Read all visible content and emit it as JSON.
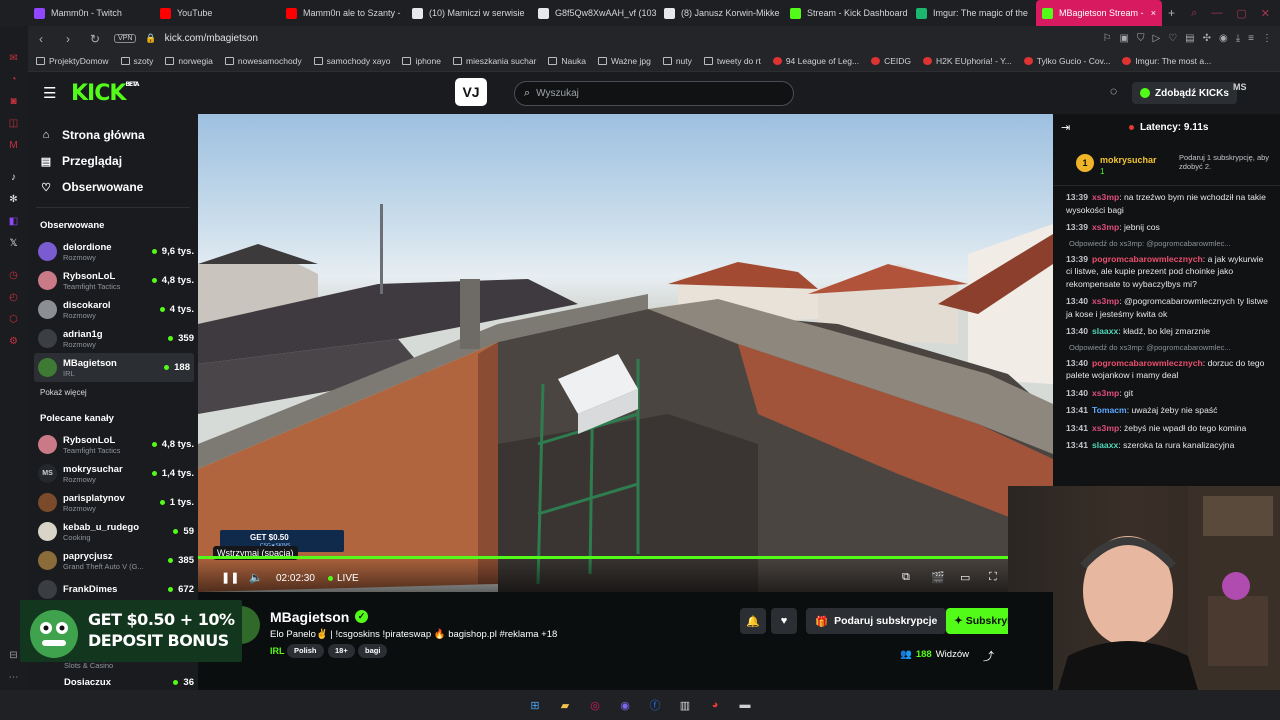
{
  "browser": {
    "tabs": [
      {
        "label": "Mamm0n - Twitch",
        "color": "#9146ff"
      },
      {
        "label": "YouTube",
        "color": "#ff0000"
      },
      {
        "label": "Mamm0n ale to Szanty -",
        "color": "#ff0000"
      },
      {
        "label": "(10) Mamiczi w serwisie",
        "color": "#e6e8ea"
      },
      {
        "label": "G8f5Qw8XwAAH_vf (103",
        "color": "#e6e8ea"
      },
      {
        "label": "(8) Janusz Korwin-Mikke",
        "color": "#e6e8ea"
      },
      {
        "label": "Stream - Kick Dashboard",
        "color": "#53fc18"
      },
      {
        "label": "Imgur: The magic of the",
        "color": "#1bb76e"
      },
      {
        "label": "MBagietson Stream -",
        "color": "#53fc18",
        "active": true
      }
    ],
    "new_tab": "+",
    "vpn_label": "VPN",
    "url": "kick.com/mbagietson",
    "bookmarks": [
      "ProjektyDomow",
      "szoty",
      "norwegia",
      "nowesamochody",
      "samochody xayo",
      "iphone",
      "mieszkania suchar",
      "Nauka",
      "Ważne jpg",
      "nuty",
      "tweety do rt",
      "94 League of Leg...",
      "CEIDG",
      "H2K EUphoria! - Y...",
      "Tylko Gucio - Cov...",
      "Imgur: The most a..."
    ]
  },
  "kick": {
    "logo": "KICK",
    "logo_beta": "BETA",
    "vj_label": "VJ",
    "search_placeholder": "Wyszukaj",
    "kicks_button": "Zdobądź KICKs",
    "user_initials": "MS",
    "nav": [
      {
        "label": "Strona główna",
        "icon": "home-icon"
      },
      {
        "label": "Przeglądaj",
        "icon": "browse-icon"
      },
      {
        "label": "Obserwowane",
        "icon": "heart-icon"
      }
    ],
    "followed_heading": "Obserwowane",
    "followed": [
      {
        "name": "delordione",
        "category": "Rozmowy",
        "viewers": "9,6 tys.",
        "color": "#7a5bd0"
      },
      {
        "name": "RybsonLoL",
        "category": "Teamfight Tactics",
        "viewers": "4,8 tys.",
        "color": "#c97a86"
      },
      {
        "name": "discokarol",
        "category": "Rozmowy",
        "viewers": "4 tys.",
        "color": "#8b8f94"
      },
      {
        "name": "adrian1g",
        "category": "Rozmowy",
        "viewers": "359",
        "color": "#3b3f44"
      },
      {
        "name": "MBagietson",
        "category": "IRL",
        "viewers": "188",
        "color": "#3f7a34",
        "selected": true
      }
    ],
    "show_more": "Pokaż więcej",
    "recommended_heading": "Polecane kanały",
    "recommended": [
      {
        "name": "RybsonLoL",
        "category": "Teamfight Tactics",
        "viewers": "4,8 tys.",
        "color": "#c97a86"
      },
      {
        "name": "mokrysuchar",
        "category": "Rozmowy",
        "viewers": "1,4 tys.",
        "color": "#24272b",
        "initials": "MS"
      },
      {
        "name": "parisplatynov",
        "category": "Rozmowy",
        "viewers": "1 tys.",
        "color": "#7a4a2a"
      },
      {
        "name": "kebab_u_rudego",
        "category": "Cooking",
        "viewers": "59",
        "color": "#d8d4c8"
      },
      {
        "name": "paprycjusz",
        "category": "Grand Theft Auto V (G...",
        "viewers": "385",
        "color": "#8a6b3a"
      },
      {
        "name": "FrankDimes",
        "category": "",
        "viewers": "672",
        "color": "#3a3d42"
      }
    ],
    "hidden_tail": [
      {
        "category": "Slots & Casino"
      },
      {
        "name": "Dosiaczux",
        "viewers": "36"
      }
    ]
  },
  "player": {
    "tooltip": "Wstrzymaj (spacja)",
    "time": "02:02:30",
    "live": "LIVE",
    "progress": 0.947,
    "overlay_ad": "GET $0.50",
    "overlay_brand": "CSG★SKINS"
  },
  "chat": {
    "latency": "Latency: 9.11s",
    "pinned_user": "mokrysuchar",
    "pinned_badge": "1",
    "pinned_count": "1",
    "pinned_note": "Podaruj 1 subskrypcję, aby zdobyć 2.",
    "messages": [
      {
        "time": "13:39",
        "user": "xs3mp",
        "color": "#e04d7c",
        "text": "na trzeźwo bym nie wchodził na takie wysokości bagi"
      },
      {
        "time": "13:39",
        "user": "xs3mp",
        "color": "#e04d7c",
        "text": "jebnij cos"
      },
      {
        "reply": "Odpowiedź do xs3mp: @pogromcabarowmlec..."
      },
      {
        "time": "13:39",
        "user": "pogromcabarowmlecznych",
        "color": "#ec4f6e",
        "text": "a jak wykurwie ci listwe, ale kupie prezent pod choinke jako rekompensate to wybaczylbys mi?"
      },
      {
        "time": "13:40",
        "user": "xs3mp",
        "color": "#e04d7c",
        "text": "@pogromcabarowmlecznych ty listwe ja kose i jesteśmy kwita ok"
      },
      {
        "time": "13:40",
        "user": "slaaxx",
        "color": "#52d6b9",
        "text": "kładź, bo klej zmarznie"
      },
      {
        "reply": "Odpowiedź do xs3mp: @pogromcabarowmlec..."
      },
      {
        "time": "13:40",
        "user": "pogromcabarowmlecznych",
        "color": "#ec4f6e",
        "text": "dorzuc do tego palete wojankow i mamy deal"
      },
      {
        "time": "13:40",
        "user": "xs3mp",
        "color": "#e04d7c",
        "text": "git"
      },
      {
        "time": "13:41",
        "user": "Tomacm",
        "color": "#5fa8ff",
        "text": "uważaj żeby nie spaść"
      },
      {
        "time": "13:41",
        "user": "xs3mp",
        "color": "#e04d7c",
        "text": "żebyś nie wpadł do tego komina"
      },
      {
        "time": "13:41",
        "user": "slaaxx",
        "color": "#52d6b9",
        "text": "szeroka ta rura kanalizacyjna"
      }
    ]
  },
  "stream": {
    "channel": "MBagietson",
    "title": "Elo Panelo✌️ | !csgoskins !pirateswap 🔥 bagishop.pl #reklama +18",
    "category": "IRL",
    "tags": [
      "Polish",
      "18+",
      "bagi"
    ],
    "gift_button": "Podaruj subskrypcje",
    "subscribe_button": "Subskrybuj",
    "viewers_count": "188",
    "viewers_label": "Widzów"
  },
  "ad": {
    "line1": "GET $0.50 + 10%",
    "line2": "DEPOSIT BONUS"
  },
  "colors": {
    "kick_green": "#53fc18",
    "tab_active": "#d81b60",
    "panel": "#191b1f"
  }
}
